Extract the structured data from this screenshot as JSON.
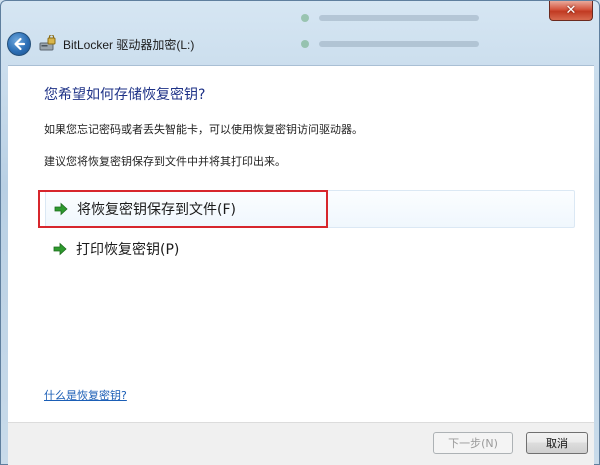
{
  "window": {
    "title": "BitLocker 驱动器加密(L:)",
    "close_glyph": "✕"
  },
  "content": {
    "heading": "您希望如何存储恢复密钥?",
    "paragraph1": "如果您忘记密码或者丢失智能卡，可以使用恢复密钥访问驱动器。",
    "paragraph2": "建议您将恢复密钥保存到文件中并将其打印出来。",
    "options": [
      {
        "label": "将恢复密钥保存到文件(F)",
        "icon": "green-arrow-icon",
        "highlighted": true
      },
      {
        "label": "打印恢复密钥(P)",
        "icon": "green-arrow-icon",
        "highlighted": false
      }
    ],
    "help_link": "什么是恢复密钥?"
  },
  "footer": {
    "next_label": "下一步(N)",
    "next_enabled": false,
    "cancel_label": "取消"
  },
  "colors": {
    "heading": "#1e3287",
    "highlight_border": "#d7262c",
    "link": "#1b5eb6",
    "arrow": "#2e9a2e"
  }
}
